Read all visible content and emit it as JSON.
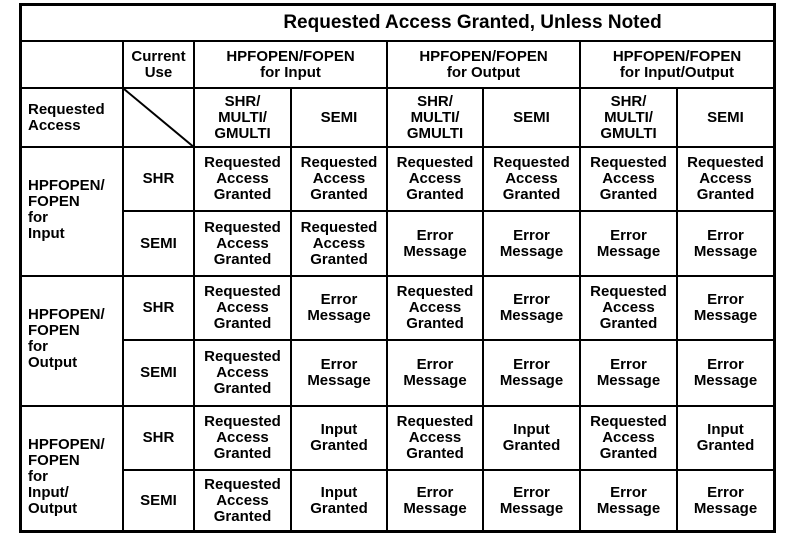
{
  "title": "Requested Access Granted, Unless Noted",
  "header": {
    "current_use_label": "Current\nUse",
    "requested_access_label": "Requested\nAccess",
    "groups": [
      {
        "label": "HPFOPEN/FOPEN\nfor Input"
      },
      {
        "label": "HPFOPEN/FOPEN\nfor Output"
      },
      {
        "label": "HPFOPEN/FOPEN\nfor Input/Output"
      }
    ],
    "subcolumns": [
      "SHR/\nMULTI/\nGMULTI",
      "SEMI",
      "SHR/\nMULTI/\nGMULTI",
      "SEMI",
      "SHR/\nMULTI/\nGMULTI",
      "SEMI"
    ]
  },
  "row_groups": [
    {
      "label": "HPFOPEN/\nFOPEN\nfor\nInput",
      "rows": [
        {
          "mode": "SHR",
          "cells": [
            "Requested\nAccess\nGranted",
            "Requested\nAccess\nGranted",
            "Requested\nAccess\nGranted",
            "Requested\nAccess\nGranted",
            "Requested\nAccess\nGranted",
            "Requested\nAccess\nGranted"
          ]
        },
        {
          "mode": "SEMI",
          "cells": [
            "Requested\nAccess\nGranted",
            "Requested\nAccess\nGranted",
            "Error\nMessage",
            "Error\nMessage",
            "Error\nMessage",
            "Error\nMessage"
          ]
        }
      ]
    },
    {
      "label": "HPFOPEN/\nFOPEN\nfor\nOutput",
      "rows": [
        {
          "mode": "SHR",
          "cells": [
            "Requested\nAccess\nGranted",
            "Error\nMessage",
            "Requested\nAccess\nGranted",
            "Error\nMessage",
            "Requested\nAccess\nGranted",
            "Error\nMessage"
          ]
        },
        {
          "mode": "SEMI",
          "cells": [
            "Requested\nAccess\nGranted",
            "Error\nMessage",
            "Error\nMessage",
            "Error\nMessage",
            "Error\nMessage",
            "Error\nMessage"
          ]
        }
      ]
    },
    {
      "label": "HPFOPEN/\nFOPEN\nfor\nInput/\nOutput",
      "rows": [
        {
          "mode": "SHR",
          "cells": [
            "Requested\nAccess\nGranted",
            "Input\nGranted",
            "Requested\nAccess\nGranted",
            "Input\nGranted",
            "Requested\nAccess\nGranted",
            "Input\nGranted"
          ]
        },
        {
          "mode": "SEMI",
          "cells": [
            "Requested\nAccess\nGranted",
            "Input\nGranted",
            "Error\nMessage",
            "Error\nMessage",
            "Error\nMessage",
            "Error\nMessage"
          ]
        }
      ]
    }
  ]
}
